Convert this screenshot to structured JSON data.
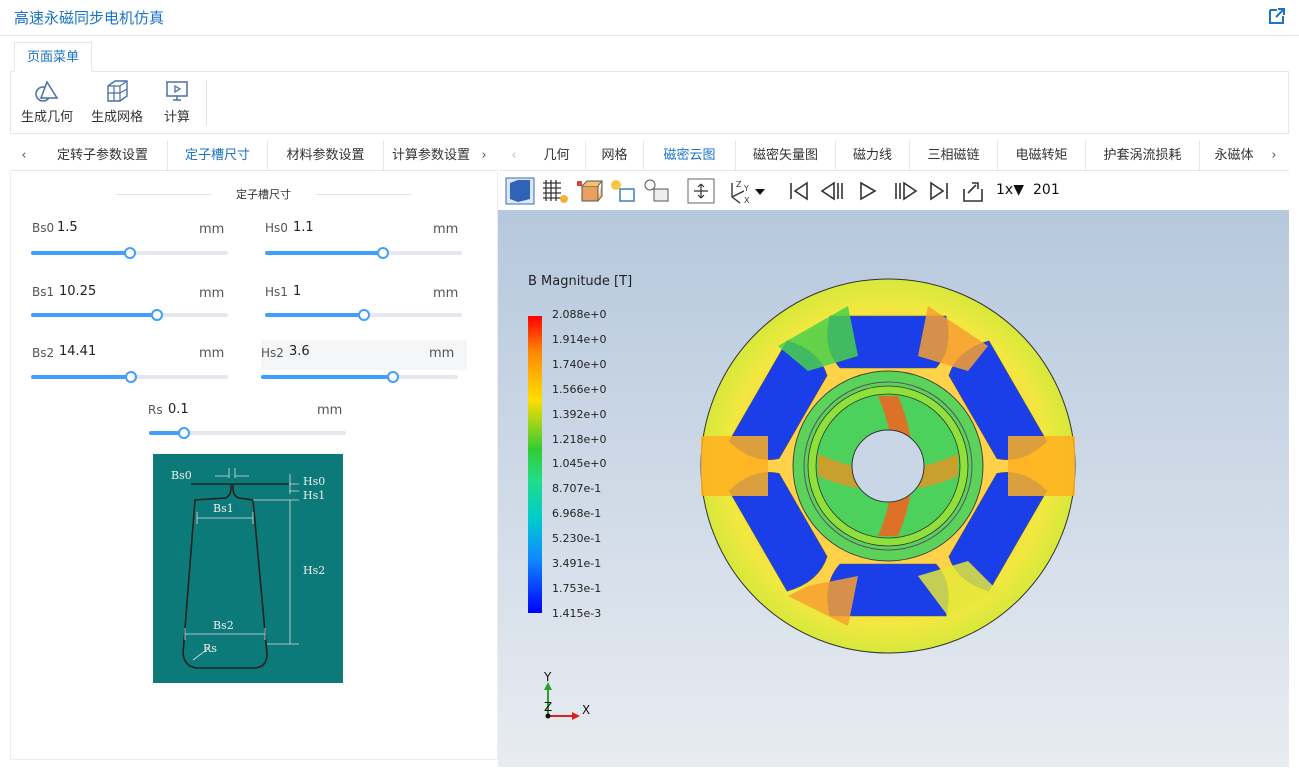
{
  "app": {
    "title": "高速永磁同步电机仿真"
  },
  "menu": {
    "tab": "页面菜单"
  },
  "toolbar": {
    "items": [
      "生成几何",
      "生成网格",
      "计算"
    ]
  },
  "left_tabs": {
    "items": [
      "定转子参数设置",
      "定子槽尺寸",
      "材料参数设置",
      "计算参数设置"
    ],
    "active": "定子槽尺寸"
  },
  "right_tabs": {
    "items": [
      "几何",
      "网格",
      "磁密云图",
      "磁密矢量图",
      "磁力线",
      "三相磁链",
      "电磁转矩",
      "护套涡流损耗",
      "永磁体"
    ],
    "active": "磁密云图"
  },
  "slot": {
    "title": "定子槽尺寸",
    "unit": "mm",
    "bs0": {
      "label": "Bs0",
      "value": "1.5",
      "fraction": 0.5
    },
    "hs0": {
      "label": "Hs0",
      "value": "1.1",
      "fraction": 0.6
    },
    "bs1": {
      "label": "Bs1",
      "value": "10.25",
      "fraction": 0.64
    },
    "hs1": {
      "label": "Hs1",
      "value": "1",
      "fraction": 0.5
    },
    "bs2": {
      "label": "Bs2",
      "value": "14.41",
      "fraction": 0.51
    },
    "hs2": {
      "label": "Hs2",
      "value": "3.6",
      "fraction": 0.67
    },
    "rs": {
      "label": "Rs",
      "value": "0.1",
      "fraction": 0.18
    }
  },
  "diagram": {
    "labels": [
      "Bs0",
      "Hs0",
      "Hs1",
      "Bs1",
      "Hs2",
      "Bs2",
      "Rs"
    ]
  },
  "viewer": {
    "speed": "1x▼",
    "frame": "201",
    "legend": {
      "title": "B Magnitude [T]",
      "ticks": [
        "2.088e+0",
        "1.914e+0",
        "1.740e+0",
        "1.566e+0",
        "1.392e+0",
        "1.218e+0",
        "1.045e+0",
        "8.707e-1",
        "6.968e-1",
        "5.230e-1",
        "3.491e-1",
        "1.753e-1",
        "1.415e-3"
      ]
    },
    "axes": {
      "y": "Y",
      "z": "Z",
      "x": "X"
    }
  },
  "colors": {
    "accent": "#1a73c9",
    "slider": "#409eff",
    "diagram_bg": "#0c7a78"
  }
}
